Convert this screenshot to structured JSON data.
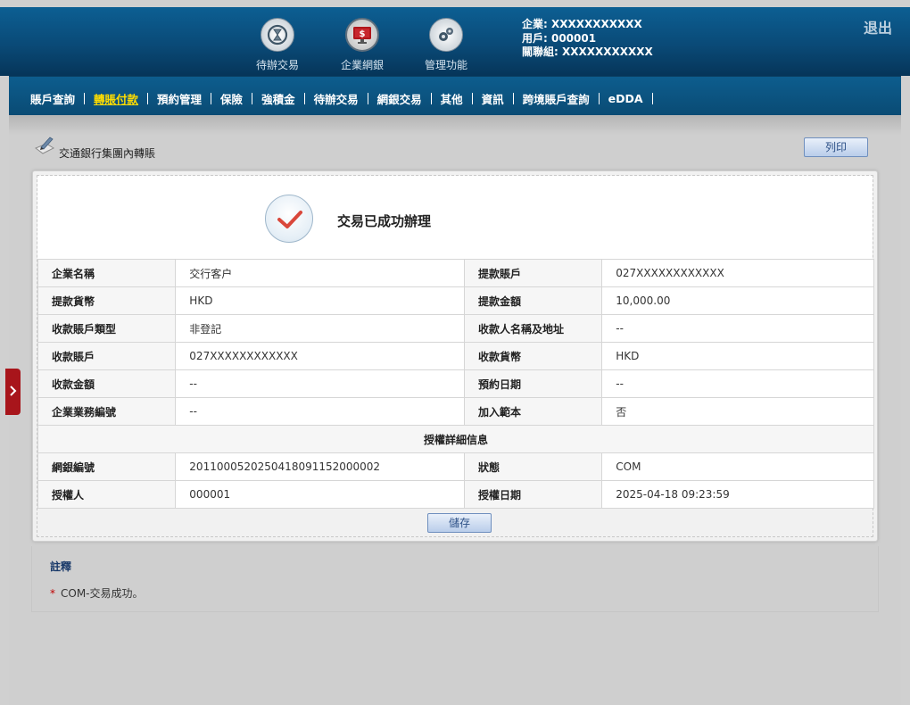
{
  "header": {
    "icons": [
      {
        "label": "待辦交易",
        "icon": "hourglass-icon"
      },
      {
        "label": "企業網銀",
        "icon": "monitor-dollar-icon"
      },
      {
        "label": "管理功能",
        "icon": "gears-icon"
      }
    ],
    "company": "企業: XXXXXXXXXXX",
    "user": "用戶: 000001",
    "group": "關聯組: XXXXXXXXXXX",
    "logout": "退出"
  },
  "nav": {
    "items": [
      "賬戶查詢",
      "轉賬付款",
      "預約管理",
      "保險",
      "強積金",
      "待辦交易",
      "網銀交易",
      "其他",
      "資訊",
      "跨境賬戶查詢",
      "eDDA"
    ],
    "active": "轉賬付款"
  },
  "page": {
    "title": "交通銀行集團內轉賬",
    "print_label": "列印",
    "success_message": "交易已成功辦理",
    "save_label": "儲存"
  },
  "details": [
    {
      "k1": "企業名稱",
      "v1": "交行客户",
      "k2": "提款賬戶",
      "v2": "027XXXXXXXXXXXX"
    },
    {
      "k1": "提款貨幣",
      "v1": "HKD",
      "k2": "提款金額",
      "v2": "10,000.00"
    },
    {
      "k1": "收款賬戶類型",
      "v1": "非登記",
      "k2": "收款人名稱及地址",
      "v2": "--"
    },
    {
      "k1": "收款賬戶",
      "v1": "027XXXXXXXXXXXX",
      "k2": "收款貨幣",
      "v2": "HKD"
    },
    {
      "k1": "收款金額",
      "v1": "--",
      "k2": "預約日期",
      "v2": "--"
    },
    {
      "k1": "企業業務編號",
      "v1": "--",
      "k2": "加入範本",
      "v2": "否"
    }
  ],
  "auth": {
    "section_title": "授權詳細信息",
    "rows": [
      {
        "k1": "網銀編號",
        "v1": "201100052025041809115200000​2",
        "k2": "狀態",
        "v2": "COM"
      },
      {
        "k1": "授權人",
        "v1": "000001",
        "k2": "授權日期",
        "v2": "2025-04-18 09:23:59"
      }
    ]
  },
  "notes": {
    "title": "註釋",
    "star": "*",
    "line": "COM-交易成功。"
  },
  "colors": {
    "header": "#0a4a77",
    "nav": "#0b5383",
    "active_nav": "#ffdd00",
    "side_tab": "#a8151b",
    "check": "#d9473b"
  }
}
